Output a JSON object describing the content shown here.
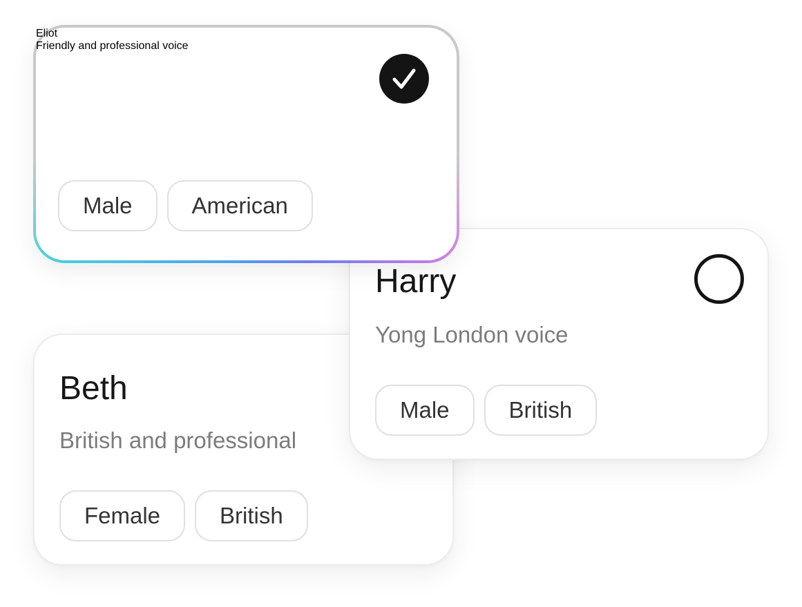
{
  "voices": {
    "eliot": {
      "name": "Eliot",
      "description": "Friendly and professional voice",
      "tags": [
        "Male",
        "American"
      ],
      "selected": true
    },
    "harry": {
      "name": "Harry",
      "description": "Yong London voice",
      "tags": [
        "Male",
        "British"
      ],
      "selected": false
    },
    "beth": {
      "name": "Beth",
      "description": "British and professional",
      "tags": [
        "Female",
        "British"
      ],
      "selected": false
    }
  },
  "icons": {
    "selected": "check-circle-icon",
    "unselected": "empty-circle-icon"
  },
  "colors": {
    "selected_border_gradient": [
      "#47d6d6",
      "#4aa3ef",
      "#6d7af5",
      "#d57be4"
    ],
    "radio_fill": "#141414"
  }
}
